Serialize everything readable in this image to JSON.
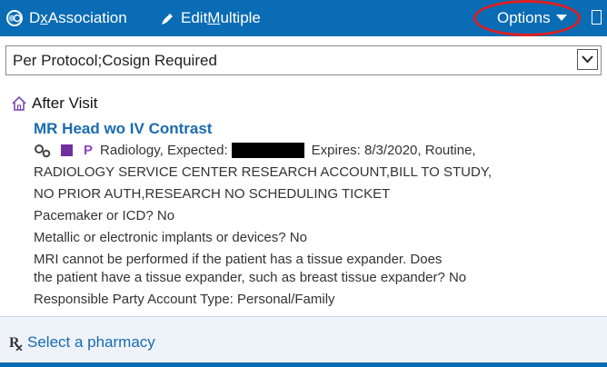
{
  "toolbar": {
    "dx_prefix": "D",
    "dx_underlined": "x",
    "dx_suffix": " Association",
    "edit_prefix": "Edit ",
    "edit_underlined": "M",
    "edit_suffix": "ultiple",
    "options_label": "Options"
  },
  "protocol_select": {
    "value": "Per Protocol;Cosign Required"
  },
  "section": {
    "title": "After Visit"
  },
  "order": {
    "title": "MR Head wo IV Contrast",
    "priority_letter": "P",
    "dept_expected": "Radiology, Expected:",
    "expires": "Expires: 8/3/2020, Routine,",
    "line2": "RADIOLOGY SERVICE CENTER RESEARCH ACCOUNT,BILL TO STUDY,",
    "line3": "NO PRIOR AUTH,RESEARCH NO SCHEDULING TICKET",
    "line4": "Pacemaker or ICD? No",
    "line5": "Metallic or electronic implants or devices? No",
    "line6": "MRI cannot be performed if the patient has a tissue expander. Does",
    "line7": "the patient have a tissue expander, such as breast tissue expander? No",
    "line8": "Responsible Party Account Type: Personal/Family"
  },
  "footer": {
    "rx_symbol": "R",
    "pharmacy_link": "Select a pharmacy"
  },
  "colors": {
    "toolbar_bg": "#0a6cb4",
    "link": "#1a6bb0",
    "annotation": "#e02020",
    "priority_square": "#7030a0"
  },
  "icons": [
    "dx-association-icon",
    "pencil-icon",
    "caret-down-icon",
    "house-icon",
    "gears-icon",
    "rx-icon"
  ]
}
